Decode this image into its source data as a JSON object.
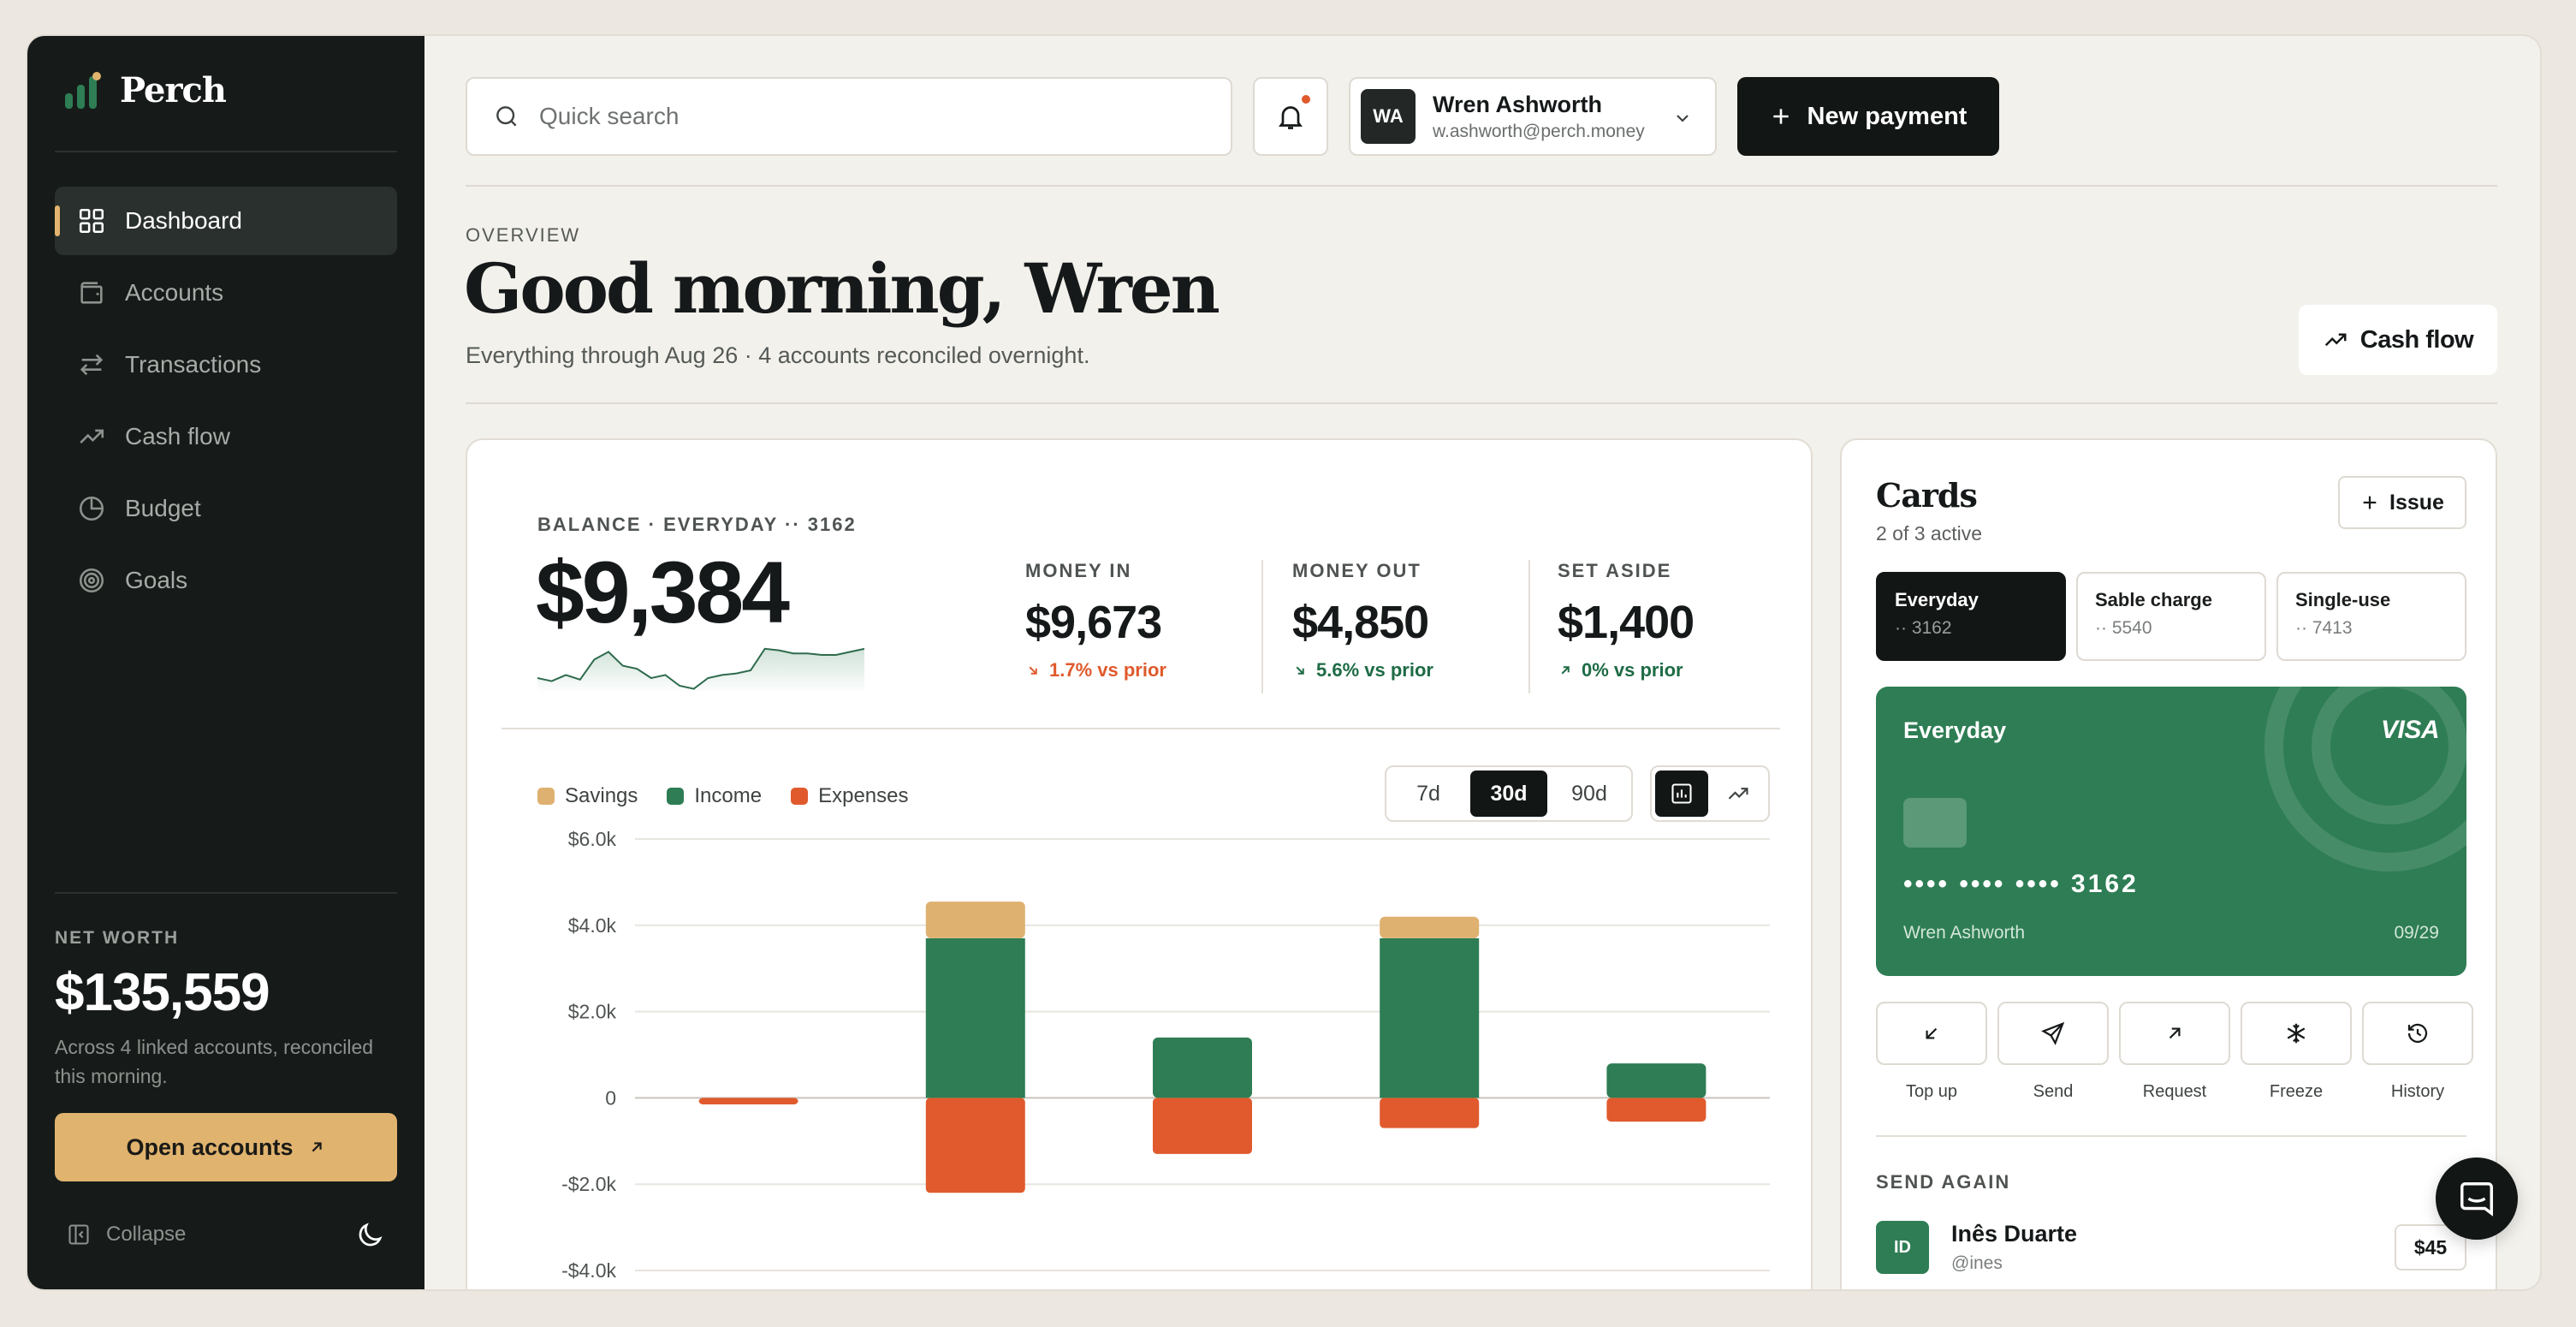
{
  "brand": {
    "name": "Perch",
    "accent": "#2e7d54",
    "gold": "#e0b36f",
    "orange": "#e05a2d"
  },
  "sidebar": {
    "items": [
      {
        "label": "Dashboard",
        "icon": "grid-icon",
        "active": true
      },
      {
        "label": "Accounts",
        "icon": "wallet-icon"
      },
      {
        "label": "Transactions",
        "icon": "arrows-swap-icon"
      },
      {
        "label": "Cash flow",
        "icon": "trend-up-icon"
      },
      {
        "label": "Budget",
        "icon": "pie-icon"
      },
      {
        "label": "Goals",
        "icon": "target-icon"
      }
    ],
    "net_worth_label": "NET WORTH",
    "net_worth_value": "$135,559",
    "net_worth_note": "Across 4 linked accounts, reconciled this morning.",
    "open_accounts": "Open accounts",
    "collapse": "Collapse"
  },
  "topbar": {
    "search_placeholder": "Quick search",
    "user": {
      "initials": "WA",
      "name": "Wren Ashworth",
      "email": "w.ashworth@perch.money"
    },
    "new_payment": "New payment"
  },
  "header": {
    "eyebrow": "OVERVIEW",
    "greeting": "Good morning, Wren",
    "subtitle": "Everything through Aug 26 · 4 accounts reconciled overnight.",
    "cash_flow_button": "Cash flow"
  },
  "balance": {
    "label": "BALANCE · EVERYDAY ·· 3162",
    "value": "$9,384",
    "sparkline": [
      20,
      22,
      18,
      21,
      8,
      3,
      12,
      14,
      20,
      18,
      25,
      27,
      20,
      18,
      17,
      15,
      1,
      2,
      4,
      4,
      5,
      5,
      3,
      1
    ]
  },
  "stats": [
    {
      "label": "MONEY IN",
      "value": "$9,673",
      "change": "1.7% vs prior",
      "dir": "down",
      "color": "#e05a2d"
    },
    {
      "label": "MONEY OUT",
      "value": "$4,850",
      "change": "5.6% vs prior",
      "dir": "down",
      "color": "#1e6b45"
    },
    {
      "label": "SET ASIDE",
      "value": "$1,400",
      "change": "0% vs prior",
      "dir": "up",
      "color": "#1e6b45"
    }
  ],
  "range": {
    "options": [
      "7d",
      "30d",
      "90d"
    ],
    "selected": "30d"
  },
  "chart_data": {
    "type": "bar",
    "stacked": true,
    "categories": [
      "",
      "",
      "",
      "",
      ""
    ],
    "series": [
      {
        "name": "Income",
        "color": "#2e7d54",
        "values": [
          0,
          3700,
          1400,
          3700,
          800
        ]
      },
      {
        "name": "Savings",
        "color": "#dfb170",
        "values": [
          0,
          850,
          0,
          500,
          0
        ]
      },
      {
        "name": "Expenses",
        "color": "#e05a2d",
        "values": [
          -150,
          -2200,
          -1300,
          -700,
          -550
        ]
      }
    ],
    "ylim": [
      -4000,
      6000
    ],
    "yticks": [
      "$6.0k",
      "$4.0k",
      "$2.0k",
      "0",
      "-$2.0k",
      "-$4.0k"
    ],
    "legend": [
      "Savings",
      "Income",
      "Expenses"
    ],
    "grid": true
  },
  "cards": {
    "title": "Cards",
    "subtitle": "2 of 3 active",
    "issue": "Issue",
    "tabs": [
      {
        "name": "Everyday",
        "num": "·· 3162",
        "active": true
      },
      {
        "name": "Sable charge",
        "num": "·· 5540"
      },
      {
        "name": "Single-use",
        "num": "·· 7413"
      }
    ],
    "card": {
      "name": "Everyday",
      "network": "VISA",
      "number": "•••• •••• •••• 3162",
      "holder": "Wren Ashworth",
      "expiry": "09/29"
    },
    "actions": [
      {
        "label": "Top up",
        "icon": "arrow-down-left-icon"
      },
      {
        "label": "Send",
        "icon": "send-icon"
      },
      {
        "label": "Request",
        "icon": "arrow-up-right-icon"
      },
      {
        "label": "Freeze",
        "icon": "snowflake-icon"
      },
      {
        "label": "History",
        "icon": "history-icon"
      }
    ],
    "send_again_label": "SEND AGAIN",
    "contact": {
      "initials": "ID",
      "name": "Inês Duarte",
      "handle": "@ines",
      "amount": "$45"
    }
  }
}
